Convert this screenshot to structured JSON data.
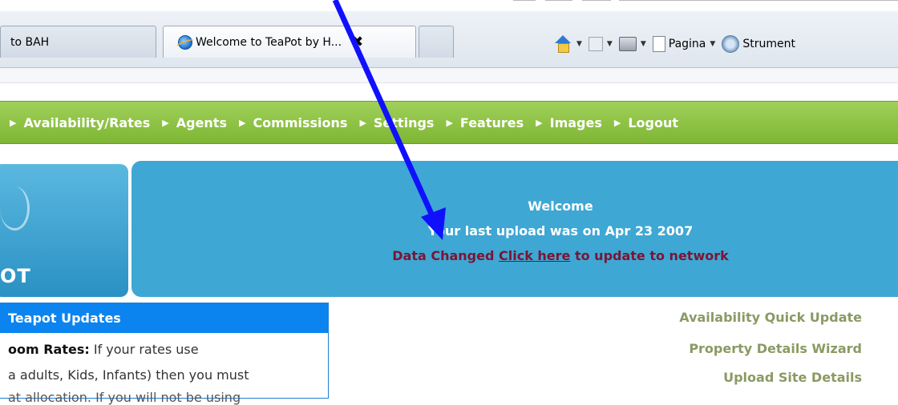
{
  "browser": {
    "tabs": [
      {
        "label": "to BAH"
      },
      {
        "label": "Welcome to TeaPot by H...",
        "close": "✖"
      },
      {
        "label": ""
      }
    ],
    "commands": {
      "page_label": "Pagina",
      "tools_label": "Strument"
    }
  },
  "menu": {
    "items": [
      "Availability/Rates",
      "Agents",
      "Commissions",
      "Settings",
      "Features",
      "Images",
      "Logout"
    ]
  },
  "logo": {
    "text": "OT"
  },
  "welcome": {
    "title": "Welcome",
    "upload_text": "Your last upload was on Apr 23 2007",
    "changed_prefix": "Data Changed ",
    "link_text": "Click here",
    "changed_suffix": " to update to network"
  },
  "updates": {
    "title": "Teapot Updates",
    "line1_bold": "oom Rates:",
    "line1_rest": " If your rates use",
    "line2": "a adults, Kids, Infants) then you must",
    "line3": "at allocation. If you will not be using"
  },
  "quick_links": [
    "Availability Quick Update",
    "Property Details Wizard",
    "Upload Site Details"
  ],
  "colors": {
    "menu_green": "#8cc63f",
    "welcome_blue": "#3fa7d3",
    "updates_header_blue": "#0b84f0",
    "annotation_arrow": "#1010ff"
  }
}
